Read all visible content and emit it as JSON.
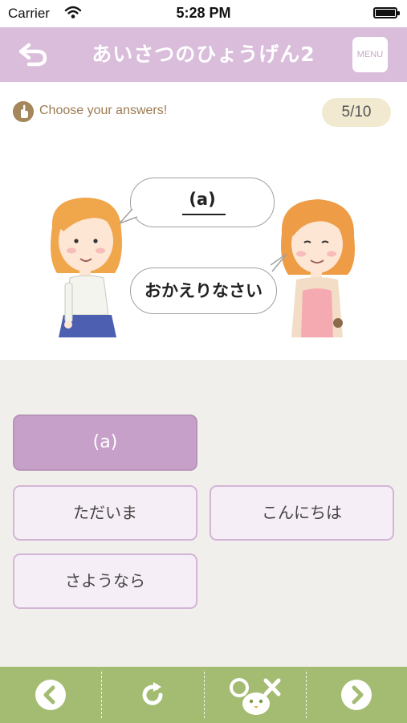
{
  "status_bar": {
    "carrier": "Carrier",
    "time": "5:28 PM"
  },
  "header": {
    "title": "あいさつのひょうげん2",
    "menu_label": "MENU",
    "back_icon": "back-arrow-icon"
  },
  "quiz": {
    "instruction": "Choose your answers!",
    "progress": "5/10",
    "bubble_blank": "(a)",
    "bubble_reply": "おかえりなさい"
  },
  "answers": {
    "slot_label": "(a)",
    "options": [
      "ただいま",
      "こんにちは",
      "さようなら"
    ]
  },
  "toolbar": {
    "icons": [
      "chevron-left-icon",
      "refresh-icon",
      "answer-check-icon",
      "chevron-right-icon"
    ]
  },
  "colors": {
    "header": "#d9bddb",
    "selected": "#c7a0c9",
    "option_bg": "#f6eef6",
    "toolbar": "#a3bc72",
    "progress_bg": "#f1ead1"
  }
}
